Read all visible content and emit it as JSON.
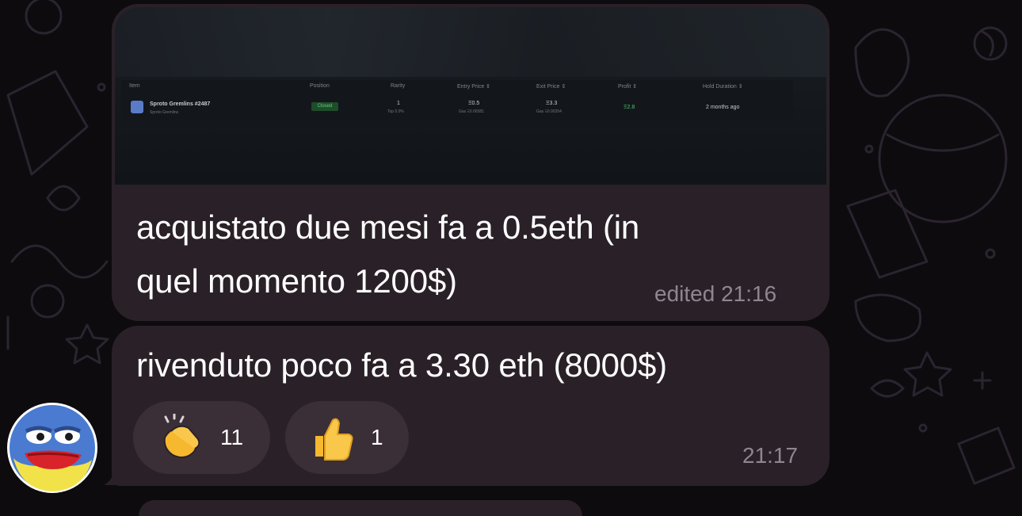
{
  "message1": {
    "screenshot": {
      "headers": [
        "Item",
        "Position",
        "Rarity",
        "Entry Price ⇕",
        "Exit Price ⇕",
        "Profit ⇕",
        "Hold Duration ⇕"
      ],
      "item_name": "Sproto Gremlins #2487",
      "item_collection": "Sproto Gremlins",
      "position": "Closed",
      "rarity": "1",
      "rarity_sub": "Top 0.0%",
      "entry_price": "Ξ0.5",
      "entry_gas": "Gas Ξ0.00381",
      "exit_price": "Ξ3.3",
      "exit_gas": "Gas Ξ0.00354",
      "profit": "Ξ2.8",
      "hold_duration": "2 months ago"
    },
    "line1": "acquistato due mesi fa a 0.5eth (in",
    "line2": "quel momento 1200$)",
    "meta": "edited 21:16"
  },
  "message2": {
    "text": "rivenduto poco fa a 3.30 eth (8000$)",
    "time": "21:17",
    "reactions": [
      {
        "icon": "clapping-hands-icon",
        "count": "11"
      },
      {
        "icon": "thumbs-up-icon",
        "count": "1"
      }
    ]
  },
  "colors": {
    "background": "#0d0b0e",
    "bubble": "#2a2128",
    "reaction_pill": "#3a2f37",
    "meta_text": "#8e8690",
    "profit_green": "#4ec36a"
  }
}
